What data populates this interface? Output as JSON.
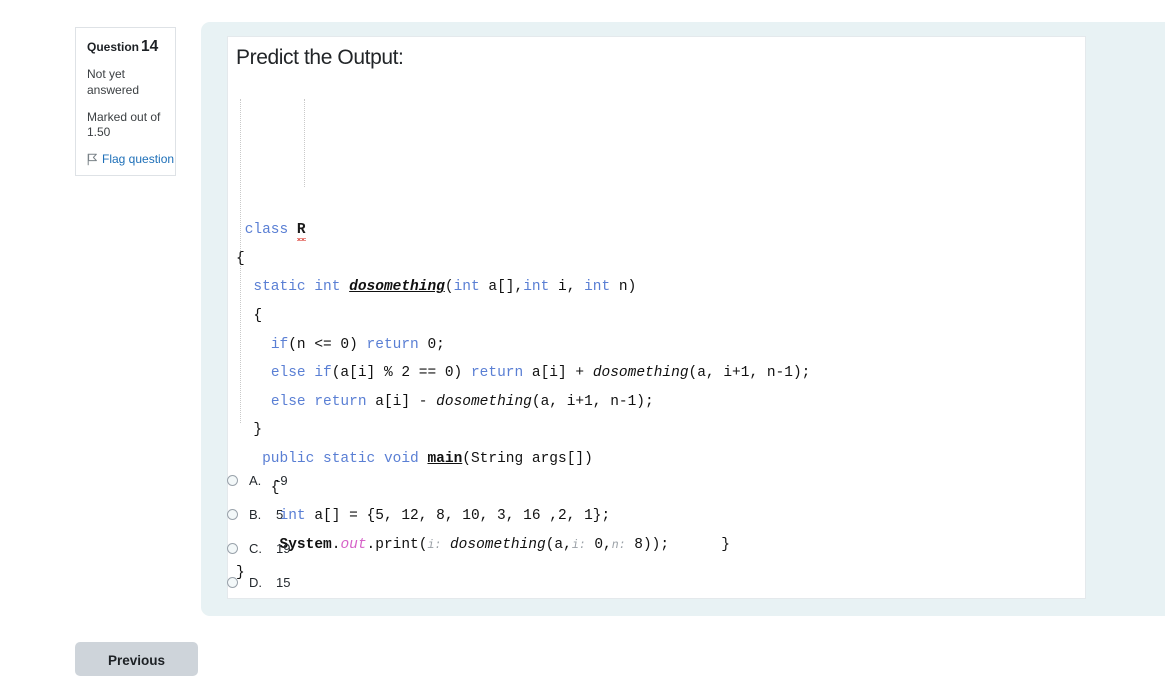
{
  "question_info": {
    "number_label": "Question",
    "number_value": "14",
    "state_text": "Not yet answered",
    "grade_text": "Marked out of 1.50",
    "flag_label": "Flag question",
    "flag_icon": "flag-outline-icon"
  },
  "question": {
    "prompt": "Predict the Output:",
    "code_lines": [
      [
        {
          "t": " ",
          "c": "pl"
        },
        {
          "t": "class",
          "c": "k"
        },
        {
          "t": " ",
          "c": "pl"
        },
        {
          "t": "R",
          "c": "sq"
        }
      ],
      [
        {
          "t": "{",
          "c": "pl"
        }
      ],
      [
        {
          "t": "  ",
          "c": "pl"
        },
        {
          "t": "static",
          "c": "k"
        },
        {
          "t": " ",
          "c": "pl"
        },
        {
          "t": "int",
          "c": "k"
        },
        {
          "t": " ",
          "c": "pl"
        },
        {
          "t": "dosomething",
          "c": "mth"
        },
        {
          "t": "(",
          "c": "pl"
        },
        {
          "t": "int",
          "c": "k"
        },
        {
          "t": " a[],",
          "c": "pl"
        },
        {
          "t": "int",
          "c": "k"
        },
        {
          "t": " i, ",
          "c": "pl"
        },
        {
          "t": "int",
          "c": "k"
        },
        {
          "t": " n)",
          "c": "pl"
        }
      ],
      [
        {
          "t": "  {",
          "c": "pl"
        }
      ],
      [
        {
          "t": "    ",
          "c": "pl"
        },
        {
          "t": "if",
          "c": "k"
        },
        {
          "t": "(n <= 0) ",
          "c": "pl"
        },
        {
          "t": "return",
          "c": "k"
        },
        {
          "t": " 0;",
          "c": "pl"
        }
      ],
      [
        {
          "t": "    ",
          "c": "pl"
        },
        {
          "t": "else",
          "c": "k"
        },
        {
          "t": " ",
          "c": "pl"
        },
        {
          "t": "if",
          "c": "k"
        },
        {
          "t": "(a[i] % 2 == 0) ",
          "c": "pl"
        },
        {
          "t": "return",
          "c": "k"
        },
        {
          "t": " a[i] + ",
          "c": "pl"
        },
        {
          "t": "dosomething",
          "c": "call"
        },
        {
          "t": "(a, i+1, n-1);",
          "c": "pl"
        }
      ],
      [
        {
          "t": "    ",
          "c": "pl"
        },
        {
          "t": "else",
          "c": "k"
        },
        {
          "t": " ",
          "c": "pl"
        },
        {
          "t": "return",
          "c": "k"
        },
        {
          "t": " a[i] - ",
          "c": "pl"
        },
        {
          "t": "dosomething",
          "c": "call"
        },
        {
          "t": "(a, i+1, n-1);",
          "c": "pl"
        }
      ],
      [
        {
          "t": "  }",
          "c": "pl"
        }
      ],
      [
        {
          "t": "   ",
          "c": "pl"
        },
        {
          "t": "public",
          "c": "k"
        },
        {
          "t": " ",
          "c": "pl"
        },
        {
          "t": "static",
          "c": "k"
        },
        {
          "t": " ",
          "c": "pl"
        },
        {
          "t": "void",
          "c": "k"
        },
        {
          "t": " ",
          "c": "pl"
        },
        {
          "t": "main",
          "c": "mthb"
        },
        {
          "t": "(String args[])",
          "c": "pl"
        }
      ],
      [
        {
          "t": "    {",
          "c": "pl"
        }
      ],
      [
        {
          "t": "     ",
          "c": "pl"
        },
        {
          "t": "int",
          "c": "k"
        },
        {
          "t": " a[] = {5, 12, 8, 10, 3, 16 ,2, 1};",
          "c": "pl"
        }
      ],
      [
        {
          "t": "     ",
          "c": "pl"
        },
        {
          "t": "System",
          "c": "bld"
        },
        {
          "t": ".",
          "c": "pl"
        },
        {
          "t": "out",
          "c": "fld"
        },
        {
          "t": ".print(",
          "c": "pl"
        },
        {
          "t": "i:",
          "c": "hint"
        },
        {
          "t": " ",
          "c": "pl"
        },
        {
          "t": "dosomething",
          "c": "call"
        },
        {
          "t": "(a,",
          "c": "pl"
        },
        {
          "t": "i:",
          "c": "hint"
        },
        {
          "t": " 0,",
          "c": "pl"
        },
        {
          "t": "n:",
          "c": "hint"
        },
        {
          "t": " 8));",
          "c": "pl"
        },
        {
          "t": "      }",
          "c": "pl"
        }
      ],
      [
        {
          "t": "}",
          "c": "pl"
        }
      ]
    ],
    "options": [
      {
        "letter": "A.",
        "value": "-9",
        "selected": false
      },
      {
        "letter": "B.",
        "value": "5",
        "selected": false
      },
      {
        "letter": "C.",
        "value": "19",
        "selected": false
      },
      {
        "letter": "D.",
        "value": "15",
        "selected": false
      }
    ]
  },
  "navigation": {
    "previous_label": "Previous"
  },
  "colors": {
    "panel_background": "#e8f2f4",
    "code_background": "#ffffff",
    "keyword": "#5a7fd4",
    "field": "#d663c8",
    "link": "#1d6fb8",
    "button": "#ced4da"
  }
}
